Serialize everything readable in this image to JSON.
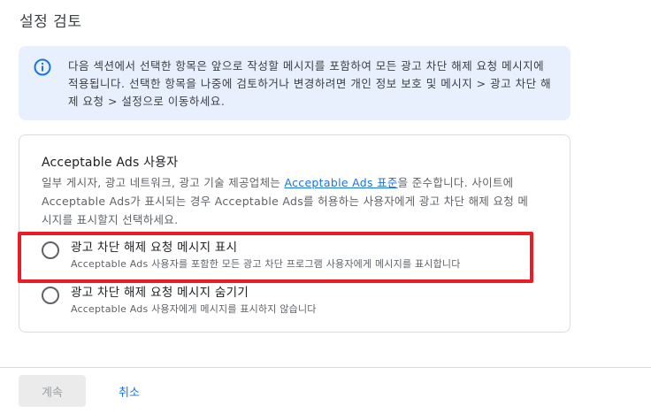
{
  "page": {
    "title": "설정 검토"
  },
  "info": {
    "icon": "info-icon",
    "text": "다음 섹션에서 선택한 항목은 앞으로 작성할 메시지를 포함하여 모든 광고 차단 해제 요청 메시지에 적용됩니다. 선택한 항목을 나중에 검토하거나 변경하려면 개인 정보 보호 및 메시지 > 광고 차단 해제 요청 > 설정으로 이동하세요."
  },
  "card": {
    "title": "Acceptable Ads 사용자",
    "desc_before": "일부 게시자, 광고 네트워크, 광고 기술 제공업체는 ",
    "desc_link": "Acceptable Ads 표준",
    "desc_after": "을 준수합니다. 사이트에 Acceptable Ads가 표시되는 경우 Acceptable Ads를 허용하는 사용자에게 광고 차단 해제 요청 메시지를 표시할지 선택하세요.",
    "options": [
      {
        "label": "광고 차단 해제 요청 메시지 표시",
        "sub": "Acceptable Ads 사용자를 포함한 모든 광고 차단 프로그램 사용자에게 메시지를 표시합니다",
        "selected": false
      },
      {
        "label": "광고 차단 해제 요청 메시지 숨기기",
        "sub": "Acceptable Ads 사용자에게 메시지를 표시하지 않습니다",
        "selected": false
      }
    ]
  },
  "footer": {
    "next_label": "계속",
    "cancel_label": "취소"
  },
  "colors": {
    "accent": "#1a73e8",
    "info_bg": "#e8f0fe",
    "highlight": "#ea1c24"
  }
}
